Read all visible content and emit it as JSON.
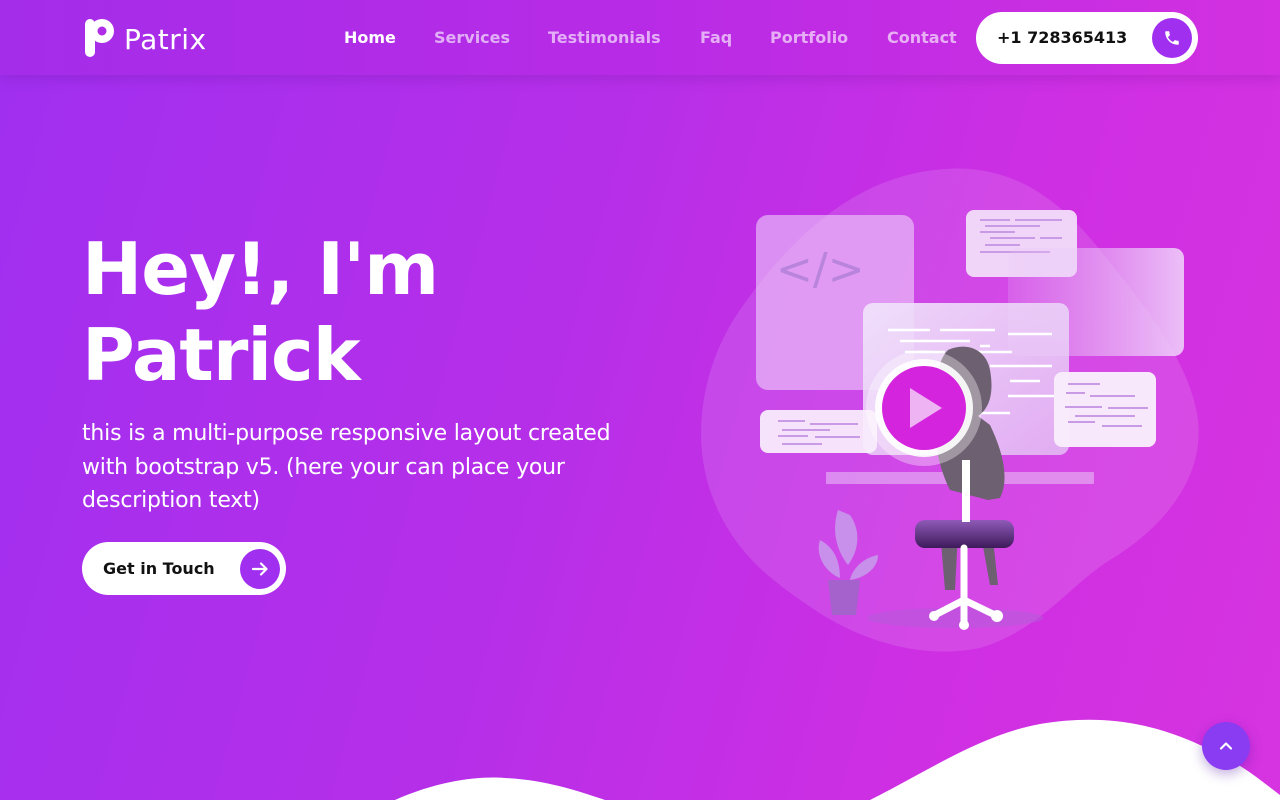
{
  "brand": {
    "name": "Patrix"
  },
  "nav": {
    "items": [
      {
        "label": "Home",
        "active": true
      },
      {
        "label": "Services",
        "active": false
      },
      {
        "label": "Testimonials",
        "active": false
      },
      {
        "label": "Faq",
        "active": false
      },
      {
        "label": "Portfolio",
        "active": false
      },
      {
        "label": "Contact",
        "active": false
      }
    ],
    "phone": "+1 728365413",
    "phone_icon": "phone-icon"
  },
  "hero": {
    "title_line1": "Hey!, I'm",
    "title_line2": "Patrick",
    "description": "this is a multi-purpose responsive layout created with bootstrap v5. (here your can place your description text)",
    "cta_label": "Get in Touch",
    "cta_icon": "arrow-right-icon",
    "code_symbol": "</>"
  },
  "back_to_top_icon": "chevron-up-icon",
  "colors": {
    "primary": "#a02ff0",
    "accent": "#d634e0",
    "white": "#ffffff"
  }
}
